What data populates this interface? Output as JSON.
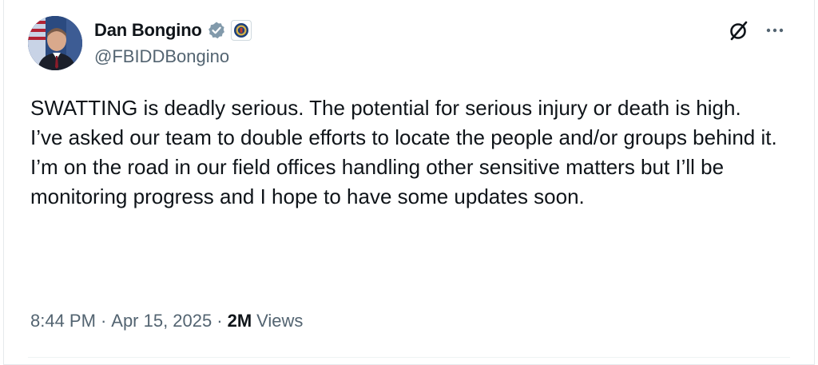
{
  "author": {
    "display_name": "Dan Bongino",
    "handle": "@FBIDDBongino",
    "verified_icon": "verified-badge-icon",
    "affiliation_icon": "fbi-seal-icon"
  },
  "actions": {
    "grok_icon": "grok-icon",
    "more_icon": "more-icon"
  },
  "tweet": {
    "text": "SWATTING is deadly serious. The potential for serious injury or death is high.\nI’ve asked our team to double efforts to locate the people and/or groups behind it. I’m on the road in our field offices handling other sensitive matters but I’ll be monitoring progress and I hope to have some updates soon.",
    "time": "8:44 PM",
    "separator": "·",
    "date": "Apr 15, 2025",
    "views_count": "2M",
    "views_label": "Views"
  },
  "colors": {
    "text_primary": "#0f1419",
    "text_secondary": "#536471",
    "verified_badge": "#829aab"
  }
}
